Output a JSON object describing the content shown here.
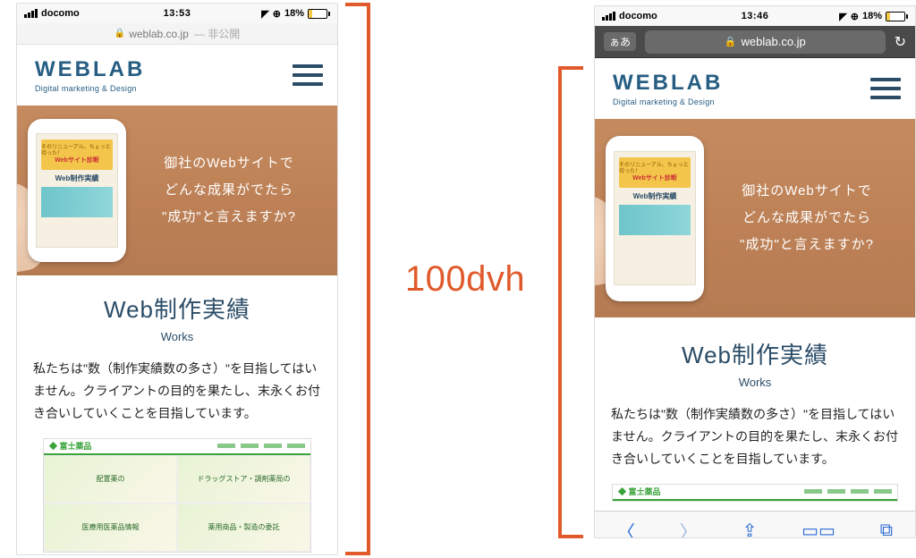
{
  "comparison": {
    "label": "100dvh"
  },
  "statusbar": {
    "carrier": "docomo",
    "time_left": "13:53",
    "time_right": "13:46",
    "battery_pct": "18%",
    "location_icon": "◤",
    "alarm_icon": "⊕"
  },
  "safari": {
    "domain": "weblab.co.jp",
    "private_suffix": "— 非公開",
    "aa": "ぁあ",
    "reload": "↻",
    "bottom": {
      "back": "〈",
      "fwd": "〉",
      "share": "⇪",
      "bookmarks": "▭▭",
      "tabs": "⧉"
    }
  },
  "page": {
    "logo_brand": "WEBLAB",
    "logo_tag": "Digital marketing & Design",
    "hero": {
      "line1": "御社のWebサイトで",
      "line2": "どんな成果がでたら",
      "line3": "\"成功\"と言えますか?",
      "mini": {
        "banner_top": "そのリニューアル、ちょっと待った！",
        "banner_mid": "Webサイト診断",
        "mini_title": "Web制作実績"
      }
    },
    "works": {
      "h2": "Web制作実績",
      "sub": "Works",
      "body": "私たちは\"数（制作実績数の多さ）\"を目指してはいません。クライアントの目的を果たし、末永くお付き合いしていくことを目指しています。",
      "thumb_logo": "◆ 富士薬品",
      "cells": [
        "配置薬の",
        "ドラッグストア・調剤薬局の",
        "医療用医薬品情報",
        "薬用商品・製造の委託"
      ]
    }
  }
}
